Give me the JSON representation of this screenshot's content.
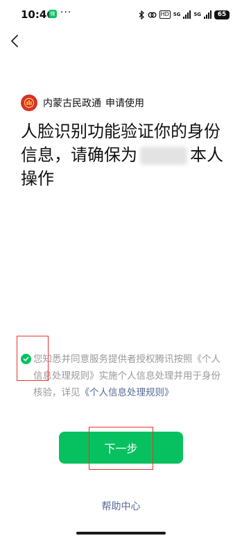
{
  "status_bar": {
    "time": "10:46",
    "wechat_badge": "微",
    "more_dots": "···",
    "hd_label": "HD",
    "network_1": "5G",
    "network_2": "5G",
    "battery": "65"
  },
  "header": {
    "back_icon": "chevron-left-icon"
  },
  "app_info": {
    "name": "内蒙古民政通",
    "apply_text": "申请使用"
  },
  "headline": {
    "part1": "人脸识别功能验证你的身份信息，请确保为",
    "part2": "本人操作"
  },
  "consent": {
    "checked": true,
    "text_before": "您知悉并同意服务提供者授权腾讯按照",
    "policy_name_1": "《个人信息处理规则》",
    "text_middle": "实施个人信息处理并用于身份核验，详见",
    "policy_link": "《个人信息处理规则》"
  },
  "actions": {
    "next_label": "下一步",
    "help_label": "帮助中心"
  },
  "colors": {
    "accent_green": "#07c160",
    "link_blue": "#576b95",
    "highlight_red": "#e8332c"
  }
}
